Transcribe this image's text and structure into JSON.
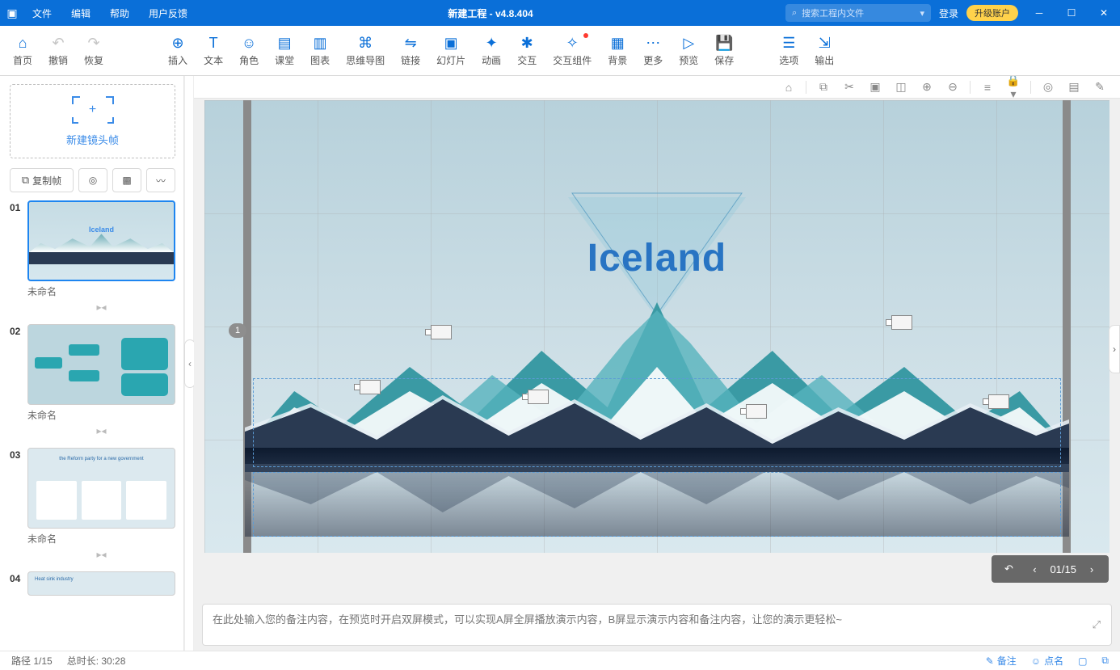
{
  "titlebar": {
    "menus": {
      "file": "文件",
      "edit": "编辑",
      "help": "帮助",
      "feedback": "用户反馈"
    },
    "title": "新建工程 - v4.8.404",
    "search_placeholder": "搜索工程内文件",
    "login": "登录",
    "upgrade": "升级账户"
  },
  "toolbar": {
    "home": "首页",
    "undo": "撤销",
    "redo": "恢复",
    "insert": "插入",
    "text": "文本",
    "role": "角色",
    "classroom": "课堂",
    "chart": "图表",
    "mindmap": "思维导图",
    "link": "链接",
    "slide": "幻灯片",
    "animation": "动画",
    "interact": "交互",
    "interact_comp": "交互组件",
    "background": "背景",
    "more": "更多",
    "preview": "预览",
    "save": "保存",
    "options": "选项",
    "output": "输出"
  },
  "sidebar": {
    "new_frame": "新建镜头帧",
    "copy_frame": "复制帧",
    "slides": [
      {
        "num": "01",
        "label": "未命名",
        "title": "Iceland"
      },
      {
        "num": "02",
        "label": "未命名",
        "title": ""
      },
      {
        "num": "03",
        "label": "未命名",
        "title": "the Reform party for a new government"
      },
      {
        "num": "04",
        "label": "",
        "title": "Heat sink industry"
      }
    ]
  },
  "canvas": {
    "title": "Iceland",
    "badge": "1",
    "nav_counter": "01/15"
  },
  "notes": {
    "placeholder": "在此处输入您的备注内容，在预览时开启双屏模式，可以实现A屏全屏播放演示内容，B屏显示演示内容和备注内容，让您的演示更轻松~"
  },
  "statusbar": {
    "path": "路径 1/15",
    "duration": "总时长: 30:28",
    "notes": "备注",
    "roll": "点名"
  }
}
